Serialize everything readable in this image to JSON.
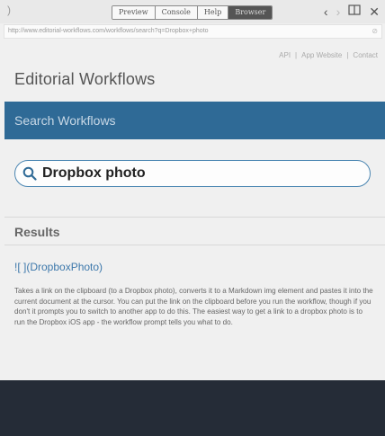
{
  "toolbar": {
    "back_glyph": ")",
    "segments": [
      "Preview",
      "Console",
      "Help",
      "Browser"
    ],
    "active_segment": "Browser",
    "nav_back": "‹",
    "nav_forward": "›",
    "book_icon": "▯",
    "close": "✕"
  },
  "urlbar": {
    "url": "http://www.editorial-workflows.com/workflows/search?q=Dropbox+photo",
    "clear_glyph": "⊘"
  },
  "topnav": {
    "items": [
      "API",
      "App Website",
      "Contact"
    ],
    "separator": "|"
  },
  "site": {
    "title": "Editorial Workflows"
  },
  "search": {
    "banner_title": "Search Workflows",
    "query": "Dropbox photo"
  },
  "results": {
    "heading": "Results",
    "items": [
      {
        "title": "![ ](DropboxPhoto)",
        "description": "Takes a link on the clipboard (to a Dropbox photo), converts it to a Markdown img element and pastes it into the current document at the cursor. You can put the link on the clipboard before you run the workflow, though if you don't it prompts you to switch to another app to do this. The easiest way to get a link to a dropbox photo is to run the Dropbox iOS app - the workflow prompt tells you what to do."
      }
    ]
  },
  "colors": {
    "banner": "#2f6a96",
    "link": "#3d78ab",
    "footer": "#252c37",
    "search_border": "#4b86b2"
  }
}
